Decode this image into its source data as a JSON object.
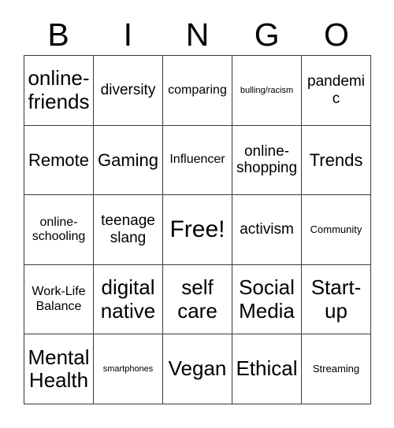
{
  "card": {
    "title": "BINGO",
    "headers": [
      "B",
      "I",
      "N",
      "G",
      "O"
    ],
    "free_space_label": "Free!",
    "colors": {
      "background": "#ffffff",
      "text": "#000000",
      "grid_line": "#3a3a3a"
    },
    "rows": [
      [
        {
          "label": "online-friends",
          "size": "xl"
        },
        {
          "label": "diversity",
          "size": "md"
        },
        {
          "label": "comparing",
          "size": "sm"
        },
        {
          "label": "bulling/racism",
          "size": "xxs"
        },
        {
          "label": "pandemic",
          "size": "md"
        }
      ],
      [
        {
          "label": "Remote",
          "size": "lg"
        },
        {
          "label": "Gaming",
          "size": "lg"
        },
        {
          "label": "Influencer",
          "size": "sm"
        },
        {
          "label": "online-shopping",
          "size": "md"
        },
        {
          "label": "Trends",
          "size": "lg"
        }
      ],
      [
        {
          "label": "online-schooling",
          "size": "sm"
        },
        {
          "label": "teenage slang",
          "size": "md"
        },
        {
          "label": "Free!",
          "size": "xxl"
        },
        {
          "label": "activism",
          "size": "md"
        },
        {
          "label": "Community",
          "size": "xs"
        }
      ],
      [
        {
          "label": "Work-Life Balance",
          "size": "sm"
        },
        {
          "label": "digital native",
          "size": "xl"
        },
        {
          "label": "self care",
          "size": "xl"
        },
        {
          "label": "Social Media",
          "size": "xl"
        },
        {
          "label": "Start-up",
          "size": "xl"
        }
      ],
      [
        {
          "label": "Mental Health",
          "size": "xl"
        },
        {
          "label": "smartphones",
          "size": "xxs"
        },
        {
          "label": "Vegan",
          "size": "xl"
        },
        {
          "label": "Ethical",
          "size": "xl"
        },
        {
          "label": "Streaming",
          "size": "xs"
        }
      ]
    ]
  }
}
